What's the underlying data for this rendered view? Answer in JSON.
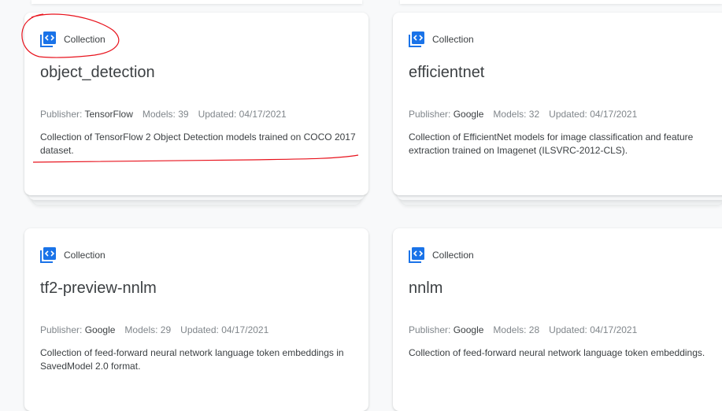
{
  "cards": [
    {
      "type_label": "Collection",
      "title": "object_detection",
      "publisher_label": "Publisher:",
      "publisher": "TensorFlow",
      "models_label": "Models:",
      "models": "39",
      "updated_label": "Updated:",
      "updated": "04/17/2021",
      "description": "Collection of TensorFlow 2 Object Detection models trained on COCO 2017 dataset."
    },
    {
      "type_label": "Collection",
      "title": "efficientnet",
      "publisher_label": "Publisher:",
      "publisher": "Google",
      "models_label": "Models:",
      "models": "32",
      "updated_label": "Updated:",
      "updated": "04/17/2021",
      "description": "Collection of EfficientNet models for image classification and feature extraction trained on Imagenet (ILSVRC-2012-CLS)."
    },
    {
      "type_label": "Collection",
      "title": "tf2-preview-nnlm",
      "publisher_label": "Publisher:",
      "publisher": "Google",
      "models_label": "Models:",
      "models": "29",
      "updated_label": "Updated:",
      "updated": "04/17/2021",
      "description": "Collection of feed-forward neural network language token embeddings in SavedModel 2.0 format."
    },
    {
      "type_label": "Collection",
      "title": "nnlm",
      "publisher_label": "Publisher:",
      "publisher": "Google",
      "models_label": "Models:",
      "models": "28",
      "updated_label": "Updated:",
      "updated": "04/17/2021",
      "description": "Collection of feed-forward neural network language token embeddings."
    }
  ],
  "icons": {
    "collection": "collection-code-icon"
  },
  "colors": {
    "icon_blue": "#1a73e8",
    "annotation_red": "#e8121c",
    "text": "#3c4043",
    "muted": "#80868b"
  }
}
